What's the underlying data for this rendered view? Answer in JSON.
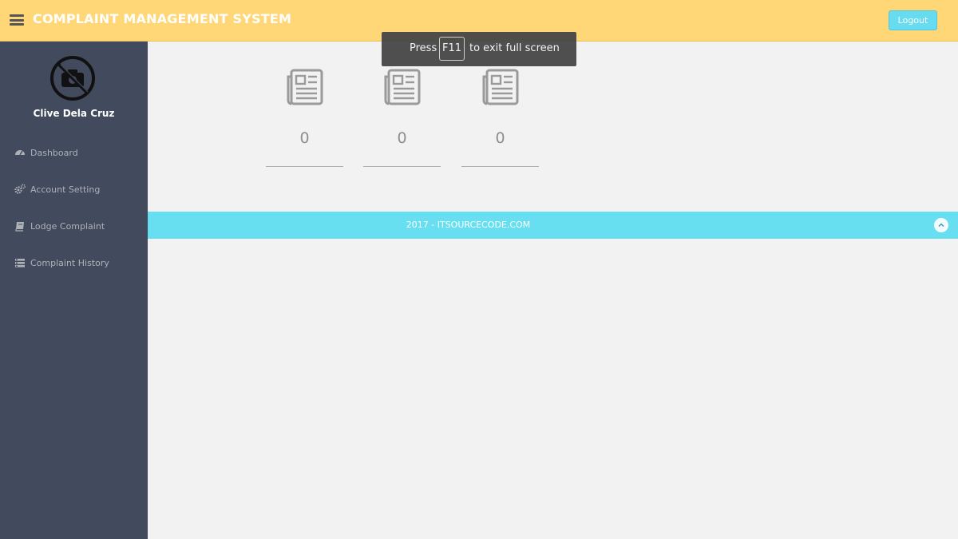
{
  "header": {
    "title": "COMPLAINT MANAGEMENT SYSTEM",
    "logout_label": "Logout",
    "bg_color": "#ffd777"
  },
  "sidebar": {
    "username": "Clive Dela Cruz",
    "items": [
      {
        "label": "Dashboard",
        "icon": "dashboard-icon"
      },
      {
        "label": "Account Setting",
        "icon": "cogs-icon"
      },
      {
        "label": "Lodge Complaint",
        "icon": "book-icon"
      },
      {
        "label": "Complaint History",
        "icon": "list-icon"
      }
    ]
  },
  "stats": [
    {
      "icon": "newspaper-icon",
      "value": "0"
    },
    {
      "icon": "newspaper-icon",
      "value": "0"
    },
    {
      "icon": "newspaper-icon",
      "value": "0"
    }
  ],
  "footer": {
    "text": "2017 - ITSOURCECODE.COM",
    "bg_color": "#68dff0"
  },
  "fullscreen_toast": {
    "before": "Press",
    "key": "F11",
    "after": "to exit full screen"
  }
}
